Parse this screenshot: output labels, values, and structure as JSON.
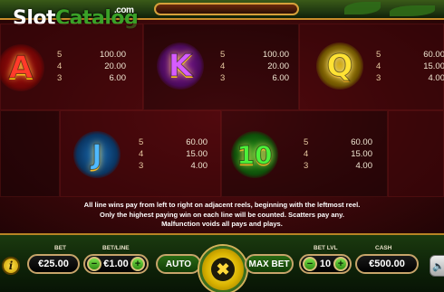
{
  "logo": {
    "slot": "Slot",
    "catalog": "Catalog",
    "com": ".com"
  },
  "paytable": {
    "A": {
      "symbol": "A",
      "rows": [
        {
          "count": "5",
          "amount": "100.00"
        },
        {
          "count": "4",
          "amount": "20.00"
        },
        {
          "count": "3",
          "amount": "6.00"
        }
      ]
    },
    "K": {
      "symbol": "K",
      "rows": [
        {
          "count": "5",
          "amount": "100.00"
        },
        {
          "count": "4",
          "amount": "20.00"
        },
        {
          "count": "3",
          "amount": "6.00"
        }
      ]
    },
    "Q": {
      "symbol": "Q",
      "rows": [
        {
          "count": "5",
          "amount": "60.00"
        },
        {
          "count": "4",
          "amount": "15.00"
        },
        {
          "count": "3",
          "amount": "4.00"
        }
      ]
    },
    "J": {
      "symbol": "J",
      "rows": [
        {
          "count": "5",
          "amount": "60.00"
        },
        {
          "count": "4",
          "amount": "15.00"
        },
        {
          "count": "3",
          "amount": "4.00"
        }
      ]
    },
    "T10": {
      "symbol": "10",
      "rows": [
        {
          "count": "5",
          "amount": "60.00"
        },
        {
          "count": "4",
          "amount": "15.00"
        },
        {
          "count": "3",
          "amount": "4.00"
        }
      ]
    }
  },
  "rules": {
    "line1": "All line wins pay from left to right on adjacent reels, beginning with the leftmost reel.",
    "line2": "Only the highest paying win on each line will be counted. Scatters pay any.",
    "line3": "Malfunction voids all pays and plays."
  },
  "controls": {
    "info_label": "i",
    "bet_caption": "BET",
    "bet_value": "€25.00",
    "betline_caption": "BET/LINE",
    "betline_value": "€1.00",
    "minus": "−",
    "plus": "+",
    "auto_label": "AUTO",
    "spin_symbol": "✖",
    "maxbet_label": "MAX BET",
    "betlvl_caption": "BET LVL",
    "betlvl_value": "10",
    "cash_caption": "CASH",
    "cash_value": "€500.00",
    "sound_icon": "🔈"
  },
  "colors": {
    "accent_gold": "#c7a46a",
    "frame_green": "#1b3a0f",
    "background_red": "#6a0f14"
  }
}
